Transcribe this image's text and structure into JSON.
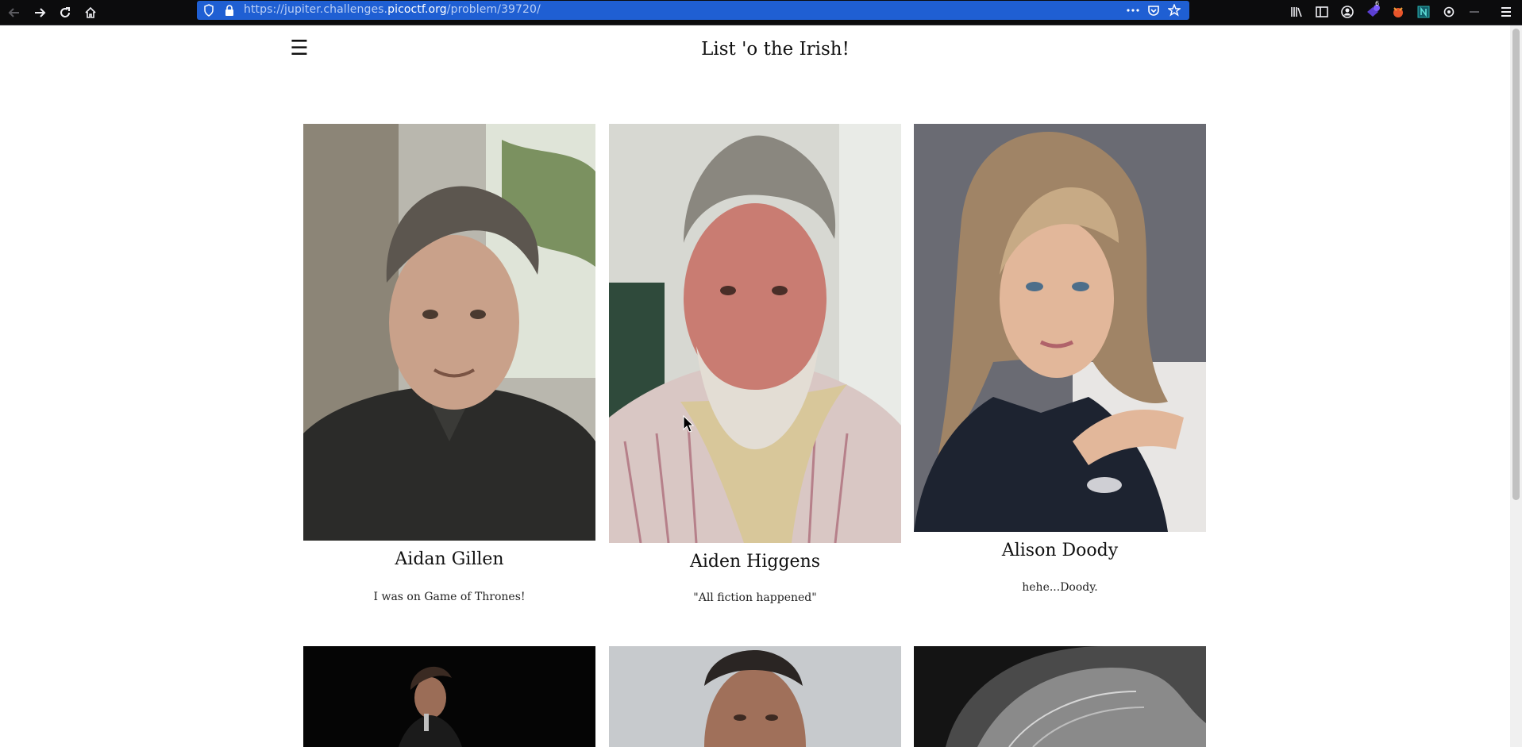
{
  "browser": {
    "url_prefix": "https://jupiter.challenges.",
    "url_host": "picoctf.org",
    "url_path": "/problem/39720/",
    "icons": [
      "back-icon",
      "forward-icon",
      "reload-icon",
      "home-icon",
      "shield-icon",
      "lock-icon",
      "more-icon",
      "pocket-icon",
      "bookmark-star-icon",
      "library-icon",
      "sidebar-icon",
      "account-icon",
      "extension-badge-icon",
      "fox-icon",
      "n-extension-icon",
      "settings-icon",
      "minus-icon",
      "hamburger-menu-icon"
    ],
    "extension_badge": "6"
  },
  "page": {
    "menu_glyph": "☰",
    "title": "List 'o the Irish!"
  },
  "cards": [
    {
      "name": "Aidan Gillen",
      "desc": "I was on Game of Thrones!"
    },
    {
      "name": "Aiden Higgens",
      "desc": "\"All fiction happened\""
    },
    {
      "name": "Alison Doody",
      "desc": "hehe...Doody."
    }
  ],
  "colors": {
    "chrome_bg": "#0c0c0d",
    "urlbar_bg": "#1f5fd3",
    "page_bg": "#ffffff",
    "text": "#111111"
  }
}
